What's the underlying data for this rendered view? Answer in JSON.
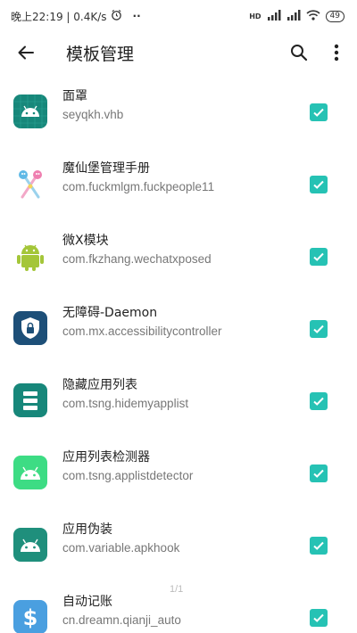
{
  "statusbar": {
    "time_speed": "晚上22:19 | 0.4K/s",
    "dots": "··",
    "signal_tag": "HD",
    "battery": "49"
  },
  "header": {
    "title": "模板管理"
  },
  "modules": [
    {
      "name": "面罩",
      "package": "seyqkh.vhb",
      "icon": "android-grid-icon",
      "checked": true
    },
    {
      "name": "魔仙堡管理手册",
      "package": "com.fuckmlgm.fuckpeople11",
      "icon": "magic-wand-icon",
      "checked": true
    },
    {
      "name": "微X模块",
      "package": "com.fkzhang.wechatxposed",
      "icon": "android-green-icon",
      "checked": true
    },
    {
      "name": "无障碍-Daemon",
      "package": "com.mx.accessibilitycontroller",
      "icon": "shield-lock-icon",
      "checked": true
    },
    {
      "name": "隐藏应用列表",
      "package": "com.tsng.hidemyapplist",
      "icon": "list-icon",
      "checked": true
    },
    {
      "name": "应用列表检测器",
      "package": "com.tsng.applistdetector",
      "icon": "android-icon",
      "checked": true
    },
    {
      "name": "应用伪装",
      "package": "com.variable.apkhook",
      "icon": "android-icon",
      "checked": true
    },
    {
      "name": "自动记账",
      "package": "cn.dreamn.qianji_auto",
      "icon": "dollar-icon",
      "checked": true
    }
  ],
  "pager": "1/1",
  "colors": {
    "accent": "#26c2b4",
    "android_teal": "#1f8f7c",
    "android_green": "#a4c639"
  }
}
